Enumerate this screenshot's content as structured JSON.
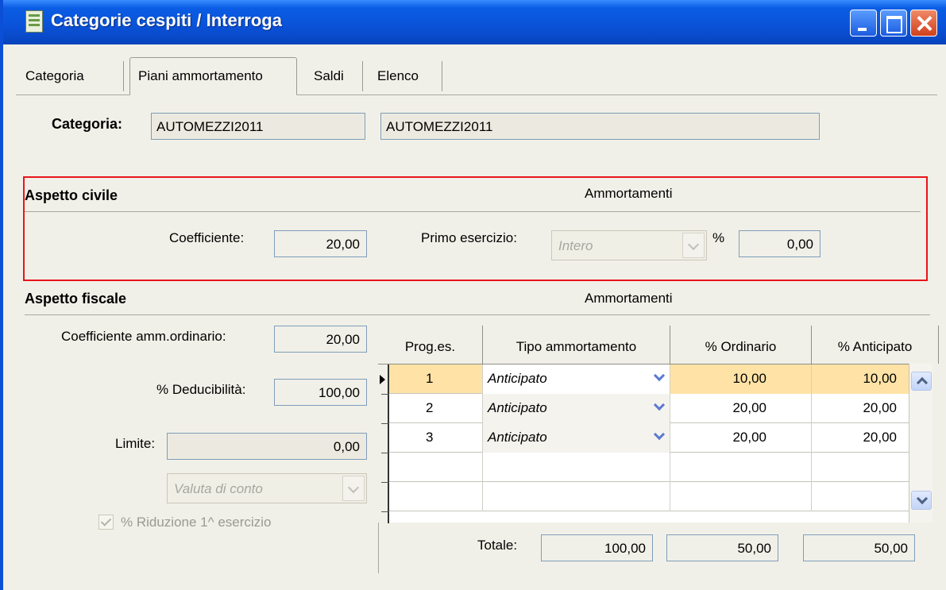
{
  "window": {
    "title": "Categorie cespiti / Interroga"
  },
  "tabs": [
    "Categoria",
    "Piani ammortamento",
    "Saldi",
    "Elenco"
  ],
  "categoria": {
    "label": "Categoria:",
    "code": "AUTOMEZZI2011",
    "description": "AUTOMEZZI2011"
  },
  "civile": {
    "title": "Aspetto civile",
    "ammortamenti_label": "Ammortamenti",
    "coefficiente_label": "Coefficiente:",
    "coefficiente_value": "20,00",
    "primo_esercizio_label": "Primo esercizio:",
    "primo_esercizio_value": "Intero",
    "percent_label": "%",
    "percent_value": "0,00"
  },
  "fiscale": {
    "title": "Aspetto fiscale",
    "ammortamenti_label": "Ammortamenti",
    "coeff_ordinario_label": "Coefficiente amm.ordinario:",
    "coeff_ordinario_value": "20,00",
    "deducibilita_label": "% Deducibilità:",
    "deducibilita_value": "100,00",
    "limite_label": "Limite:",
    "limite_value": "0,00",
    "valuta_value": "Valuta di conto",
    "riduzione_label": "% Riduzione 1^ esercizio",
    "riduzione_checked": true
  },
  "grid": {
    "columns": [
      "Prog.es.",
      "Tipo ammortamento",
      "% Ordinario",
      "% Anticipato"
    ],
    "rows": [
      {
        "prog": "1",
        "tipo": "Anticipato",
        "ordinario": "10,00",
        "anticipato": "10,00",
        "selected": true
      },
      {
        "prog": "2",
        "tipo": "Anticipato",
        "ordinario": "20,00",
        "anticipato": "20,00",
        "selected": false
      },
      {
        "prog": "3",
        "tipo": "Anticipato",
        "ordinario": "20,00",
        "anticipato": "20,00",
        "selected": false
      }
    ],
    "totale_label": "Totale:",
    "totale_prog": "100,00",
    "totale_ordinario": "50,00",
    "totale_anticipato": "50,00"
  },
  "colors": {
    "titlebar": "#0a52d8",
    "selected_row": "#ffe3a6",
    "highlight_border": "#e8141a"
  }
}
